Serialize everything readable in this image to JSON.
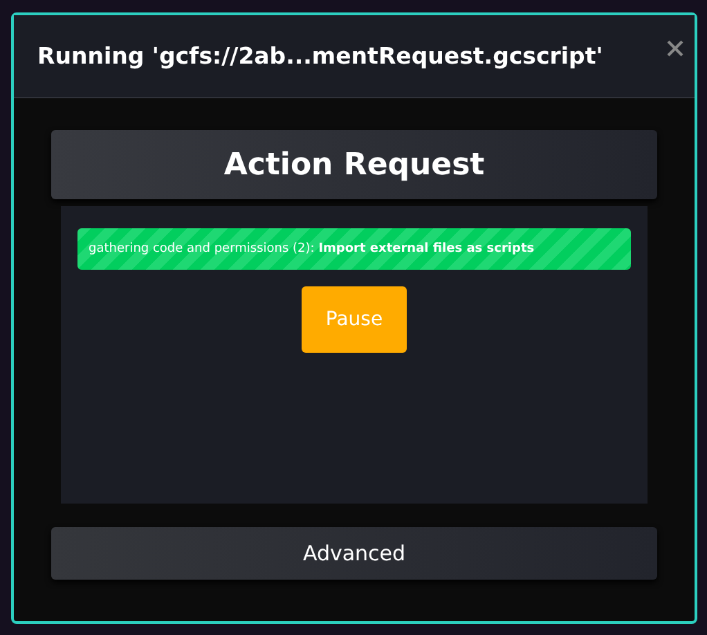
{
  "dialog": {
    "title": "Running 'gcfs://2ab...mentRequest.gcscript'"
  },
  "heading": "Action Request",
  "progress": {
    "text": "gathering code and permissions (2): **Import external files as scripts**",
    "level": 1
  },
  "buttons": [
    {
      "label": "Pause",
      "kind": "primary"
    }
  ],
  "advanced": {
    "label": "Advanced",
    "expanded": false
  }
}
